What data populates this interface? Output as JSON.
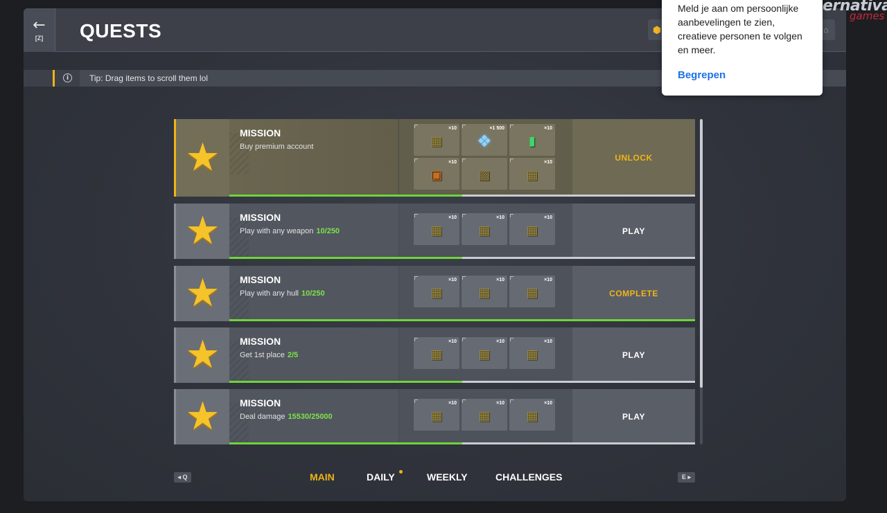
{
  "header": {
    "back_icon": "←",
    "back_key": "[Z]",
    "title": "QUESTS",
    "coin_icon": "⬢",
    "garage_icon": "⌂"
  },
  "tip": {
    "icon": "i",
    "text": "Tip: Drag items to scroll them lol"
  },
  "missions": [
    {
      "title": "MISSION",
      "description": "Buy premium account",
      "progress_text": "",
      "action": "UNLOCK",
      "action_color": "#f0b418",
      "progress_fraction": 0.5,
      "rewards": [
        {
          "qty": "×10",
          "icon": "box-icon"
        },
        {
          "qty": "×1 500",
          "icon": "crystals-icon"
        },
        {
          "qty": "×10",
          "icon": "battery-icon"
        },
        {
          "qty": "×10",
          "icon": "crate-icon"
        },
        {
          "qty": "",
          "icon": "big-crate-icon"
        },
        {
          "qty": "×10",
          "icon": "box-icon"
        }
      ]
    },
    {
      "title": "MISSION",
      "description": "Play with any weapon",
      "progress_text": "10/250",
      "action": "PLAY",
      "action_color": "#ffffff",
      "progress_fraction": 0.5,
      "rewards": [
        {
          "qty": "×10",
          "icon": "box-icon"
        },
        {
          "qty": "×10",
          "icon": "box-icon"
        },
        {
          "qty": "×10",
          "icon": "box-icon"
        }
      ]
    },
    {
      "title": "MISSION",
      "description": "Play with any hull",
      "progress_text": "10/250",
      "action": "COMPLETE",
      "action_color": "#f0b418",
      "progress_fraction": 1.0,
      "rewards": [
        {
          "qty": "×10",
          "icon": "box-icon"
        },
        {
          "qty": "×10",
          "icon": "box-icon"
        },
        {
          "qty": "×10",
          "icon": "box-icon"
        }
      ]
    },
    {
      "title": "MISSION",
      "description": "Get 1st place",
      "progress_text": "2/5",
      "action": "PLAY",
      "action_color": "#ffffff",
      "progress_fraction": 0.5,
      "rewards": [
        {
          "qty": "×10",
          "icon": "box-icon"
        },
        {
          "qty": "×10",
          "icon": "box-icon"
        },
        {
          "qty": "×10",
          "icon": "box-icon"
        }
      ]
    },
    {
      "title": "MISSION",
      "description": "Deal damage",
      "progress_text": "15530/25000",
      "action": "PLAY",
      "action_color": "#ffffff",
      "progress_fraction": 0.5,
      "rewards": [
        {
          "qty": "×10",
          "icon": "box-icon"
        },
        {
          "qty": "×10",
          "icon": "box-icon"
        },
        {
          "qty": "×10",
          "icon": "box-icon"
        }
      ]
    }
  ],
  "tabs": {
    "prev_key": "◂ Q",
    "next_key": "E ▸",
    "main": "MAIN",
    "daily": "DAILY",
    "weekly": "WEEKLY",
    "challenges": "CHALLENGES",
    "active": "main"
  },
  "brand": {
    "main": "ernativa",
    "sub": "games"
  },
  "popup": {
    "text": "Meld je aan om persoonlijke aanbevelingen te zien, creatieve personen te volgen en meer.",
    "button": "Begrepen"
  },
  "colors": {
    "accent": "#f0b418",
    "progress_green": "#6fd43a",
    "link_blue": "#1a73e8"
  }
}
